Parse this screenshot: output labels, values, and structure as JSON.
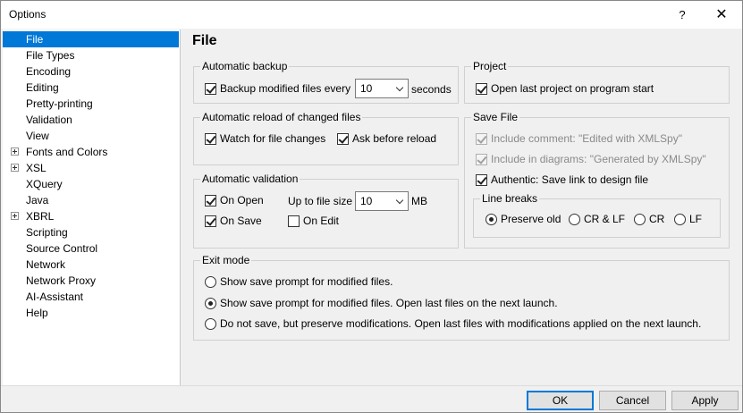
{
  "window": {
    "title": "Options",
    "help_glyph": "?",
    "close_glyph": "✕"
  },
  "tree": {
    "items": [
      {
        "label": "File",
        "selected": true,
        "expandable": false
      },
      {
        "label": "File Types",
        "selected": false,
        "expandable": false
      },
      {
        "label": "Encoding",
        "selected": false,
        "expandable": false
      },
      {
        "label": "Editing",
        "selected": false,
        "expandable": false
      },
      {
        "label": "Pretty-printing",
        "selected": false,
        "expandable": false
      },
      {
        "label": "Validation",
        "selected": false,
        "expandable": false
      },
      {
        "label": "View",
        "selected": false,
        "expandable": false
      },
      {
        "label": "Fonts and Colors",
        "selected": false,
        "expandable": true
      },
      {
        "label": "XSL",
        "selected": false,
        "expandable": true
      },
      {
        "label": "XQuery",
        "selected": false,
        "expandable": false
      },
      {
        "label": "Java",
        "selected": false,
        "expandable": false
      },
      {
        "label": "XBRL",
        "selected": false,
        "expandable": true
      },
      {
        "label": "Scripting",
        "selected": false,
        "expandable": false
      },
      {
        "label": "Source Control",
        "selected": false,
        "expandable": false
      },
      {
        "label": "Network",
        "selected": false,
        "expandable": false
      },
      {
        "label": "Network Proxy",
        "selected": false,
        "expandable": false
      },
      {
        "label": "AI-Assistant",
        "selected": false,
        "expandable": false
      },
      {
        "label": "Help",
        "selected": false,
        "expandable": false
      }
    ]
  },
  "page": {
    "title": "File"
  },
  "auto_backup": {
    "legend": "Automatic backup",
    "backup_label": "Backup modified files every",
    "backup_checked": true,
    "interval_value": "10",
    "interval_unit": "seconds"
  },
  "project": {
    "legend": "Project",
    "open_last_label": "Open last project on program start",
    "open_last_checked": true
  },
  "auto_reload": {
    "legend": "Automatic reload of changed files",
    "watch_label": "Watch for file changes",
    "watch_checked": true,
    "ask_label": "Ask before reload",
    "ask_checked": true
  },
  "save_file": {
    "legend": "Save File",
    "include_comment_label": "Include comment: \"Edited with XMLSpy\"",
    "include_comment_checked": true,
    "include_diagrams_label": "Include in diagrams: \"Generated by XMLSpy\"",
    "include_diagrams_checked": true,
    "authentic_label": "Authentic: Save link to design file",
    "authentic_checked": true,
    "line_breaks": {
      "legend": "Line breaks",
      "options": [
        "Preserve old",
        "CR & LF",
        "CR",
        "LF"
      ],
      "selected": "Preserve old"
    }
  },
  "auto_validation": {
    "legend": "Automatic validation",
    "on_open_label": "On Open",
    "on_open_checked": true,
    "on_save_label": "On Save",
    "on_save_checked": true,
    "on_edit_label": "On Edit",
    "on_edit_checked": false,
    "size_label": "Up to file size",
    "size_value": "10",
    "size_unit": "MB"
  },
  "exit_mode": {
    "legend": "Exit mode",
    "options": [
      "Show save prompt for modified files.",
      "Show save prompt for modified files. Open last files on the next launch.",
      "Do not save, but preserve modifications. Open last files with modifications applied on the next launch."
    ],
    "selected_index": 1
  },
  "buttons": {
    "ok": "OK",
    "cancel": "Cancel",
    "apply": "Apply"
  }
}
